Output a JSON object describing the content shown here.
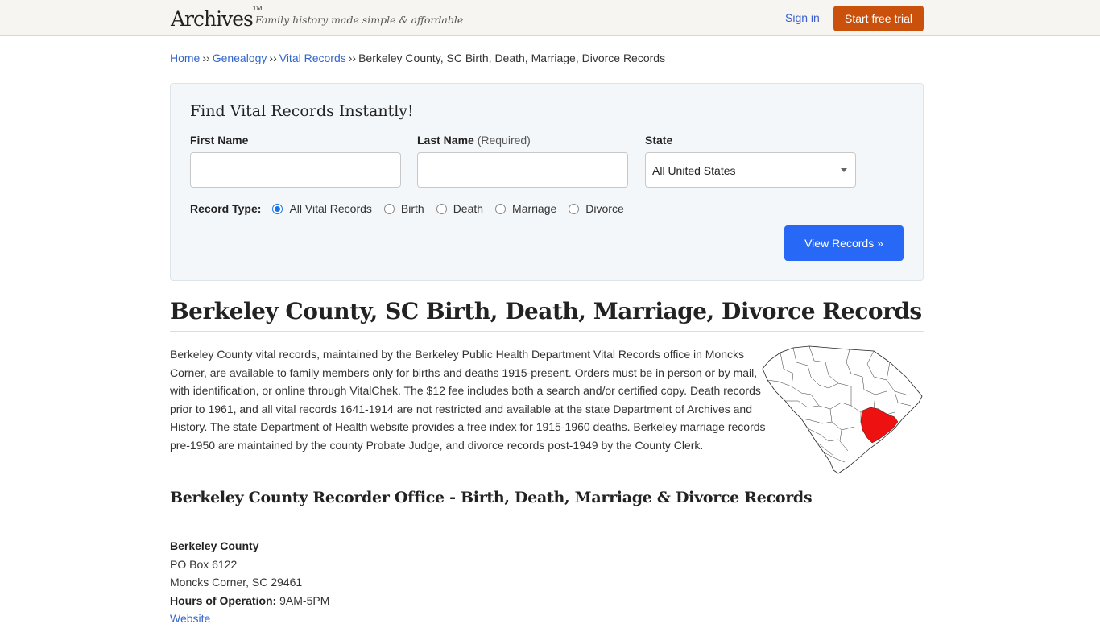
{
  "header": {
    "logo": "Archives",
    "logo_mark": "TM",
    "tagline": "Family history made simple & affordable",
    "sign_in": "Sign in",
    "start_trial": "Start free trial"
  },
  "breadcrumb": {
    "items": [
      "Home",
      "Genealogy",
      "Vital Records"
    ],
    "separator": "››",
    "current": "Berkeley County, SC Birth, Death, Marriage, Divorce Records"
  },
  "search": {
    "title": "Find Vital Records Instantly!",
    "first_name_label": "First Name",
    "first_name_value": "",
    "last_name_label": "Last Name",
    "last_name_required": "(Required)",
    "last_name_value": "",
    "state_label": "State",
    "state_value": "All United States",
    "record_type_label": "Record Type:",
    "record_types": [
      {
        "label": "All Vital Records",
        "checked": true
      },
      {
        "label": "Birth",
        "checked": false
      },
      {
        "label": "Death",
        "checked": false
      },
      {
        "label": "Marriage",
        "checked": false
      },
      {
        "label": "Divorce",
        "checked": false
      }
    ],
    "submit": "View Records »"
  },
  "main": {
    "title": "Berkeley County, SC Birth, Death, Marriage, Divorce Records",
    "intro": "Berkeley County vital records, maintained by the Berkeley Public Health Department Vital Records office in Moncks Corner, are available to family members only for births and deaths 1915-present. Orders must be in person or by mail, with identification, or online through VitalChek. The $12 fee includes both a search and/or certified copy. Death records prior to 1961, and all vital records 1641-1914 are not restricted and available at the state Department of Archives and History. The state Department of Health website provides a free index for 1915-1960 deaths. Berkeley marriage records pre-1950 are maintained by the county Probate Judge, and divorce records post-1949 by the County Clerk.",
    "map_alt": "South Carolina map with Berkeley County highlighted",
    "map_highlight_color": "#ee1111",
    "office_title": "Berkeley County Recorder Office - Birth, Death, Marriage & Divorce Records",
    "office": {
      "name": "Berkeley County",
      "address1": "PO Box 6122",
      "address2": "Moncks Corner, SC 29461",
      "hours_label": "Hours of Operation:",
      "hours": "9AM-5PM",
      "website": "Website"
    }
  },
  "colors": {
    "trial_button": "#c9510c",
    "view_button": "#2769f6",
    "link": "#3366cc"
  }
}
